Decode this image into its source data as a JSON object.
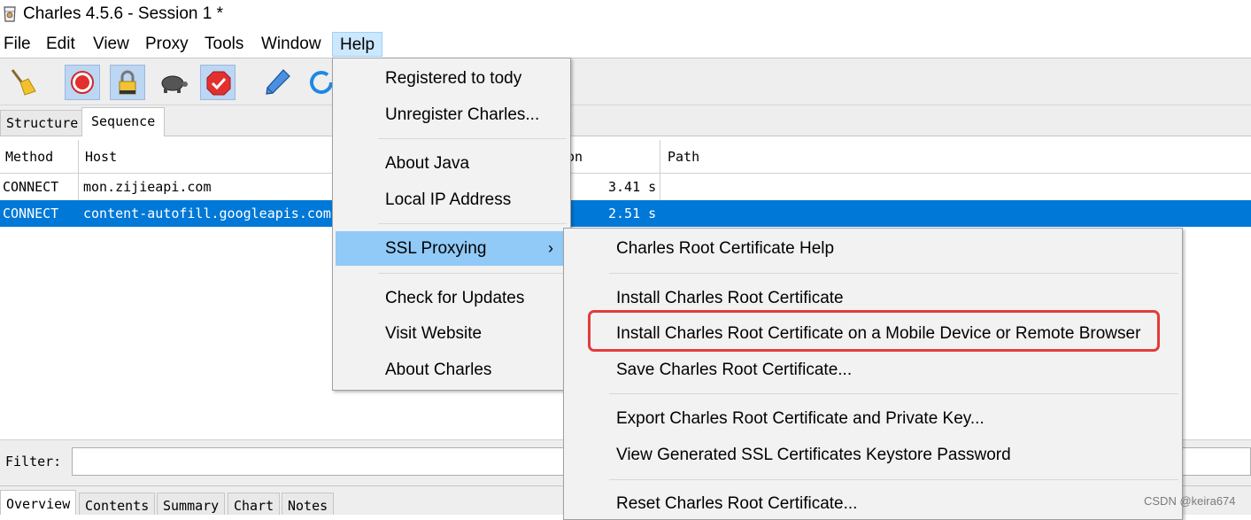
{
  "window": {
    "title": "Charles 4.5.6 - Session 1 *"
  },
  "menubar": {
    "items": [
      "File",
      "Edit",
      "View",
      "Proxy",
      "Tools",
      "Window",
      "Help"
    ]
  },
  "toolbar": {
    "icons": [
      "broom-icon",
      "record-icon",
      "lock-icon",
      "turtle-icon",
      "hexagon-check-icon",
      "pen-icon",
      "refresh-icon"
    ]
  },
  "tabs": {
    "structure": "Structure",
    "sequence": "Sequence"
  },
  "table": {
    "columns": {
      "method": "Method",
      "host": "Host",
      "duration": "on",
      "path": "Path"
    },
    "rows": [
      {
        "method": "CONNECT",
        "host": "mon.zijieapi.com",
        "duration": "3.41 s",
        "path": ""
      },
      {
        "method": "CONNECT",
        "host": "content-autofill.googleapis.com",
        "duration": "2.51 s",
        "path": "",
        "selected": true
      }
    ]
  },
  "filter": {
    "label": "Filter:",
    "value": ""
  },
  "bottom_tabs": [
    "Overview",
    "Contents",
    "Summary",
    "Chart",
    "Notes"
  ],
  "help_menu": {
    "items": [
      "Registered to tody",
      "Unregister Charles...",
      "About Java",
      "Local IP Address",
      "SSL Proxying",
      "Check for Updates",
      "Visit Website",
      "About Charles"
    ],
    "submenu_arrow": "›"
  },
  "ssl_menu": {
    "items": [
      "Charles Root Certificate Help",
      "Install Charles Root Certificate",
      "Install Charles Root Certificate on a Mobile Device or Remote Browser",
      "Save Charles Root Certificate...",
      "Export Charles Root Certificate and Private Key...",
      "View Generated SSL Certificates Keystore Password",
      "Reset Charles Root Certificate..."
    ]
  },
  "colors": {
    "selection": "#0078d7",
    "menu_highlight": "#91c9f7",
    "annotation": "#e23c3c"
  },
  "watermark": "CSDN @keira674"
}
